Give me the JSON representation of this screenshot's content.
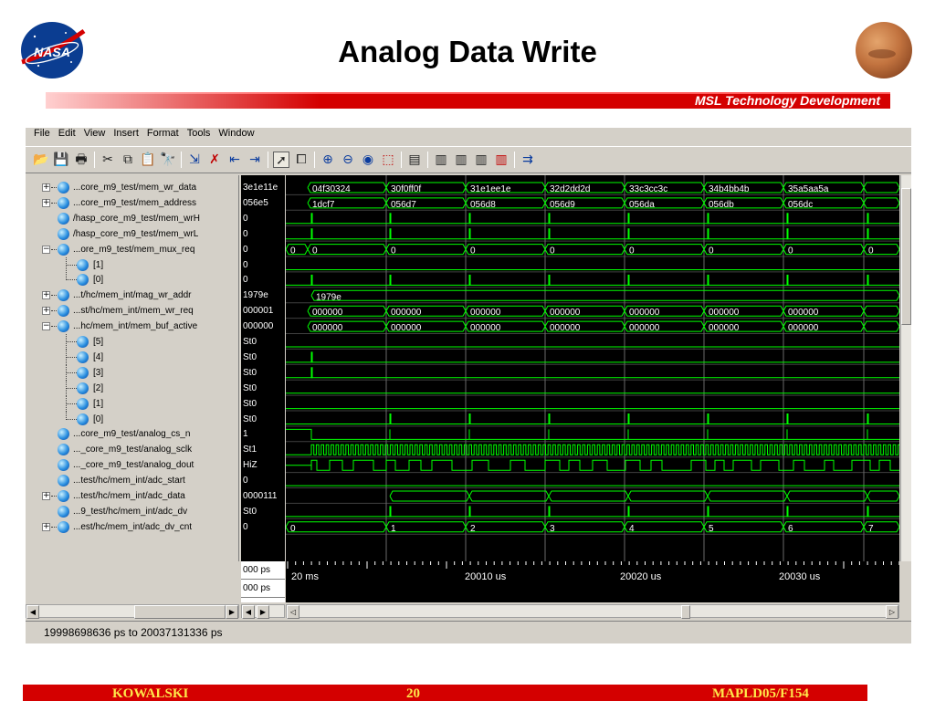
{
  "slide": {
    "title": "Analog Data Write",
    "banner": "MSL Technology Development",
    "logo_text": "NASA",
    "footer": {
      "left": "KOWALSKI",
      "center": "20",
      "right": "MAPLD05/F154"
    }
  },
  "window": {
    "menu": [
      "File",
      "Edit",
      "View",
      "Insert",
      "Format",
      "Tools",
      "Window"
    ],
    "toolbar_icons": [
      "open-folder-icon",
      "save-disk-icon",
      "print-icon",
      "cut-icon",
      "copy-icon",
      "paste-icon",
      "find-icon",
      "insert-cursor-icon",
      "delete-cursor-icon",
      "find-previous-edge-icon",
      "find-next-edge-icon",
      "select-mode-pointer-icon",
      "zoom-mode-icon",
      "zoom-in-icon",
      "zoom-out-icon",
      "zoom-full-icon",
      "zoom-cursors-icon",
      "edit-bookmark-icon",
      "expand-wave-1-icon",
      "expand-wave-2-icon",
      "expand-wave-3-icon",
      "expand-wave-4-icon",
      "restart-simulation-icon"
    ],
    "status_text": "19998698636 ps to 20037131336 ps",
    "cursor_values": [
      "000 ps",
      "000 ps"
    ],
    "colors": {
      "wave": "#00ff00",
      "background": "#000000",
      "grid": "#808080",
      "text": "#ffffff"
    }
  },
  "signals": [
    {
      "name": "...core_m9_test/mem_wr_data",
      "value": "3e1e11e",
      "expandable": true,
      "expanded": false,
      "indent": 0
    },
    {
      "name": "...core_m9_test/mem_address",
      "value": "056e5",
      "expandable": true,
      "expanded": false,
      "indent": 0
    },
    {
      "name": "/hasp_core_m9_test/mem_wrH",
      "value": "0",
      "expandable": false,
      "indent": 0
    },
    {
      "name": "/hasp_core_m9_test/mem_wrL",
      "value": "0",
      "expandable": false,
      "indent": 0
    },
    {
      "name": "...ore_m9_test/mem_mux_req",
      "value": "0",
      "expandable": true,
      "expanded": true,
      "indent": 0
    },
    {
      "name": "[1]",
      "value": "0",
      "expandable": false,
      "indent": 1
    },
    {
      "name": "[0]",
      "value": "0",
      "expandable": false,
      "indent": 1,
      "last_child": true
    },
    {
      "name": "...t/hc/mem_int/mag_wr_addr",
      "value": "1979e",
      "expandable": true,
      "expanded": false,
      "indent": 0
    },
    {
      "name": "...st/hc/mem_int/mem_wr_req",
      "value": "000001",
      "expandable": true,
      "expanded": false,
      "indent": 0
    },
    {
      "name": "...hc/mem_int/mem_buf_active",
      "value": "000000",
      "expandable": true,
      "expanded": true,
      "indent": 0
    },
    {
      "name": "[5]",
      "value": "St0",
      "expandable": false,
      "indent": 1
    },
    {
      "name": "[4]",
      "value": "St0",
      "expandable": false,
      "indent": 1
    },
    {
      "name": "[3]",
      "value": "St0",
      "expandable": false,
      "indent": 1
    },
    {
      "name": "[2]",
      "value": "St0",
      "expandable": false,
      "indent": 1
    },
    {
      "name": "[1]",
      "value": "St0",
      "expandable": false,
      "indent": 1
    },
    {
      "name": "[0]",
      "value": "St0",
      "expandable": false,
      "indent": 1,
      "last_child": true
    },
    {
      "name": "...core_m9_test/analog_cs_n",
      "value": "1",
      "expandable": false,
      "indent": 0
    },
    {
      "name": "..._core_m9_test/analog_sclk",
      "value": "St1",
      "expandable": false,
      "indent": 0
    },
    {
      "name": "..._core_m9_test/analog_dout",
      "value": "HiZ",
      "expandable": false,
      "indent": 0
    },
    {
      "name": "...test/hc/mem_int/adc_start",
      "value": "0",
      "expandable": false,
      "indent": 0
    },
    {
      "name": "...test/hc/mem_int/adc_data",
      "value": "0000111",
      "expandable": true,
      "expanded": false,
      "indent": 0
    },
    {
      "name": "...9_test/hc/mem_int/adc_dv",
      "value": "St0",
      "expandable": false,
      "indent": 0
    },
    {
      "name": "...est/hc/mem_int/adc_dv_cnt",
      "value": "0",
      "expandable": true,
      "expanded": false,
      "indent": 0
    }
  ],
  "waveform": {
    "time_labels": [
      "20 ms",
      "20010 us",
      "20020 us",
      "20030 us"
    ],
    "bus_rows": {
      "mem_wr_data": [
        "04f30324",
        "30f0ff0f",
        "31e1ee1e",
        "32d2dd2d",
        "33c3cc3c",
        "34b4bb4b",
        "35a5aa5a",
        ""
      ],
      "mem_address": [
        "1dcf7",
        "056d7",
        "056d8",
        "056d9",
        "056da",
        "056db",
        "056dc",
        ""
      ],
      "mem_mux_req": [
        "0",
        "0",
        "0",
        "0",
        "0",
        "0",
        "0",
        "0",
        "0"
      ],
      "mag_wr_addr": [
        "1979e"
      ],
      "mem_wr_req": [
        "000000",
        "000000",
        "000000",
        "000000",
        "000000",
        "000000",
        "000000",
        ""
      ],
      "mem_buf_active": [
        "000000",
        "000000",
        "000000",
        "000000",
        "000000",
        "000000",
        "000000",
        ""
      ],
      "adc_dv_cnt": [
        "0",
        "1",
        "2",
        "3",
        "4",
        "5",
        "6",
        "7"
      ]
    }
  }
}
